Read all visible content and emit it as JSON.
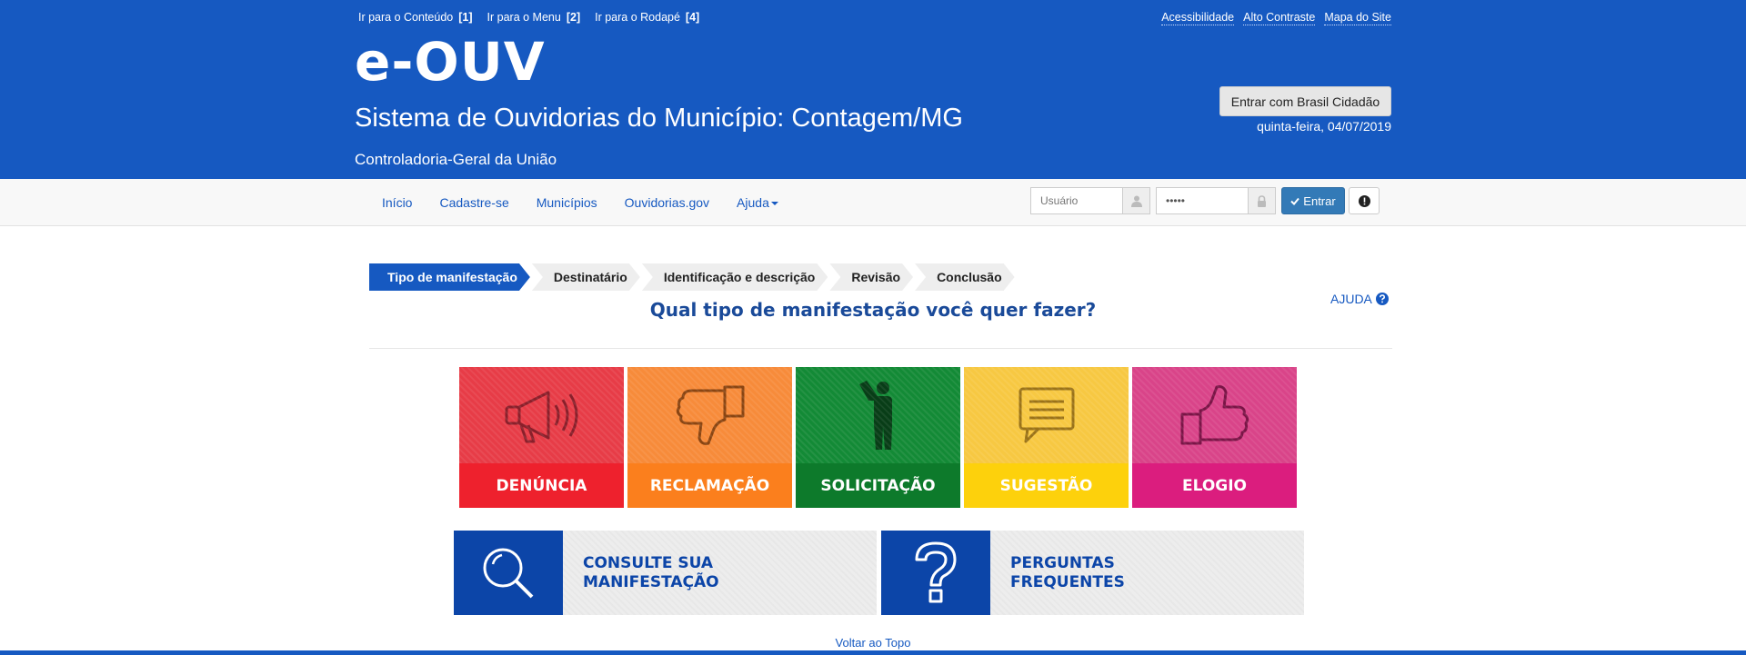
{
  "header": {
    "skip_links": [
      {
        "label": "Ir para o Conteúdo",
        "key": "[1]"
      },
      {
        "label": "Ir para o Menu",
        "key": "[2]"
      },
      {
        "label": "Ir para o Rodapé",
        "key": "[4]"
      }
    ],
    "top_links": [
      "Acessibilidade",
      "Alto Contraste",
      "Mapa do Site"
    ],
    "logo": "e-OUV",
    "subtitle": "Sistema de Ouvidorias do Município: Contagem/MG",
    "org": "Controladoria-Geral da União",
    "login_gov_label": "Entrar com Brasil Cidadão",
    "date": "quinta-feira, 04/07/2019"
  },
  "nav": {
    "items": [
      "Início",
      "Cadastre-se",
      "Municípios",
      "Ouvidorias.gov",
      "Ajuda"
    ],
    "username_placeholder": "Usuário",
    "password_value": "•••••",
    "login_label": "Entrar"
  },
  "steps": [
    "Tipo de manifestação",
    "Destinatário",
    "Identificação e descrição",
    "Revisão",
    "Conclusão"
  ],
  "active_step": 0,
  "question": "Qual tipo de manifestação você quer fazer?",
  "help_label": "AJUDA",
  "cards": [
    "DENÚNCIA",
    "RECLAMAÇÃO",
    "SOLICITAÇÃO",
    "SUGESTÃO",
    "ELOGIO"
  ],
  "boxes": {
    "consulte": {
      "line1": "CONSULTE SUA",
      "line2": "MANIFESTAÇÃO"
    },
    "perguntas": {
      "line1": "PERGUNTAS",
      "line2": "FREQUENTES"
    }
  },
  "back_to_top": "Voltar ao Topo",
  "colors": {
    "header_blue": "#1659c1",
    "denuncia": "#ee212d",
    "reclamacao": "#fb7f1d",
    "solicitacao": "#0d7a2b",
    "sugestao": "#fdd10c",
    "elogio": "#db1d7e",
    "box_blue": "#0c45a8"
  }
}
